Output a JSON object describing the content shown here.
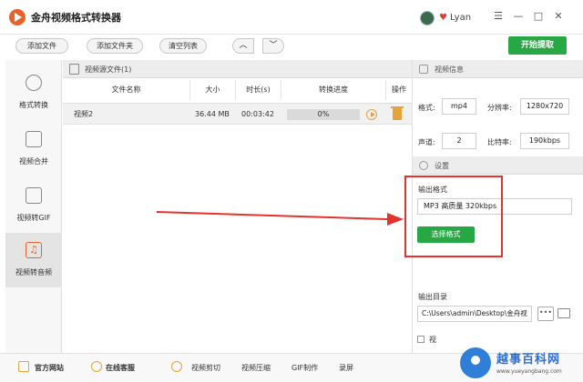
{
  "window": {
    "title": "金舟视频格式转换器",
    "user": "Lyan",
    "controls": [
      "☰",
      "—",
      "□",
      "✕"
    ]
  },
  "toolbar": {
    "add_file": "添加文件",
    "add_folder": "添加文件夹",
    "clear_list": "清空列表",
    "up": "︿",
    "down": "﹀",
    "start": "开始提取"
  },
  "sidebar": {
    "items": [
      {
        "label": "格式转换"
      },
      {
        "label": "视频合并"
      },
      {
        "label": "视频转GIF"
      },
      {
        "label": "视频转音频"
      }
    ]
  },
  "file_list": {
    "title": "视频源文件(1)",
    "columns": [
      "文件名称",
      "大小",
      "时长(s)",
      "转换进度",
      "操作"
    ],
    "rows": [
      {
        "name": "视频2",
        "size": "36.44 MB",
        "duration": "00:03:42",
        "progress": "0%"
      }
    ]
  },
  "video_info": {
    "title": "视频信息",
    "format_label": "格式:",
    "format_value": "mp4",
    "resolution_label": "分辨率:",
    "resolution_value": "1280x720",
    "channel_label": "声道:",
    "channel_value": "2",
    "bitrate_label": "比特率:",
    "bitrate_value": "190kbps"
  },
  "settings": {
    "title": "设置",
    "output_format_label": "输出格式",
    "output_format_value": "MP3 高质量 320kbps",
    "select_format": "选择格式",
    "output_dir_label": "输出目录",
    "output_dir_value": "C:\\Users\\admin\\Desktop\\金舟视",
    "more": "•••",
    "checkbox_label": "视"
  },
  "bottom_bar": {
    "official_site": "官方网站",
    "online_support": "在线客服",
    "links": [
      "视频剪切",
      "视频压缩",
      "GIF制作",
      "录屏"
    ]
  },
  "watermark": {
    "brand": "越事百科网",
    "url": "www.yueyangbang.com"
  },
  "colors": {
    "accent_green": "#28a745",
    "highlight_red": "#e2342d",
    "brand_orange": "#e8632a"
  }
}
